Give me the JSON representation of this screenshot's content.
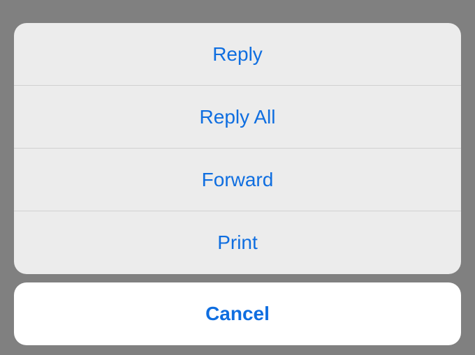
{
  "actionSheet": {
    "options": [
      {
        "label": "Reply"
      },
      {
        "label": "Reply All"
      },
      {
        "label": "Forward"
      },
      {
        "label": "Print"
      }
    ],
    "cancel": "Cancel"
  }
}
